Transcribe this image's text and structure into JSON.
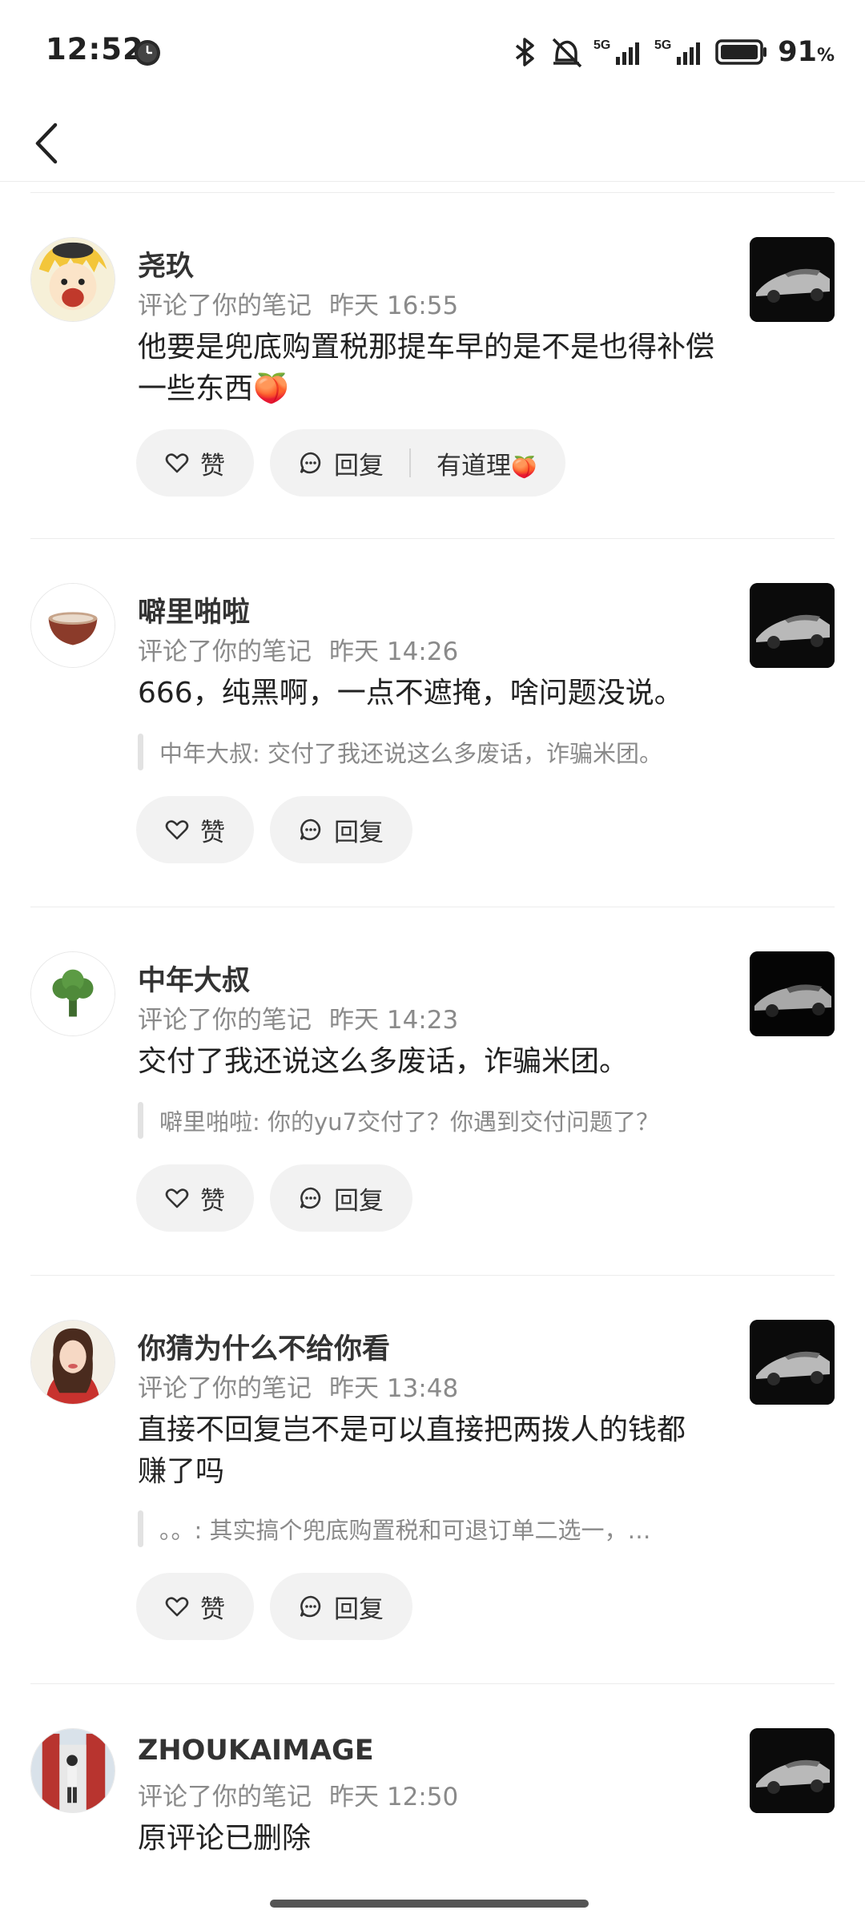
{
  "status_bar": {
    "time": "12:52",
    "battery_value": "91",
    "battery_unit": "%",
    "signal_label_1": "5G",
    "signal_label_2": "5G",
    "icons": [
      "clock-app-icon",
      "bluetooth-icon",
      "mute-icon",
      "signal-icon",
      "battery-icon"
    ]
  },
  "nav": {
    "back_icon": "chevron-left-icon",
    "title": ""
  },
  "comments": [
    {
      "username": "尧玖",
      "action": "评论了你的笔记",
      "time": "昨天 16:55",
      "text": "他要是兜底购置税那提车早的是不是也得补偿一些东西",
      "text_emoji": "🍑",
      "like_label": "赞",
      "reply_label": "回复",
      "extra_label": "有道理",
      "extra_emoji": "🍑"
    },
    {
      "username": "噼里啪啦",
      "action": "评论了你的笔记",
      "time": "昨天 14:26",
      "text": "666，纯黑啊，一点不遮掩，啥问题没说。",
      "quote": "中年大叔: 交付了我还说这么多废话，诈骗米团。",
      "like_label": "赞",
      "reply_label": "回复"
    },
    {
      "username": "中年大叔",
      "action": "评论了你的笔记",
      "time": "昨天 14:23",
      "text": "交付了我还说这么多废话，诈骗米团。",
      "quote": "噼里啪啦: 你的yu7交付了？你遇到交付问题了？",
      "like_label": "赞",
      "reply_label": "回复"
    },
    {
      "username": "你猜为什么不给你看",
      "action": "评论了你的笔记",
      "time": "昨天 13:48",
      "text": "直接不回复岂不是可以直接把两拨人的钱都赚了吗",
      "quote": "。。: 其实搞个兜底购置税和可退订单二选一，…",
      "like_label": "赞",
      "reply_label": "回复"
    },
    {
      "username": "ZHOUKAIMAGE",
      "action": "评论了你的笔记",
      "time": "昨天 12:50",
      "text": "原评论已删除"
    }
  ],
  "colors": {
    "pill_bg": "#f2f2f2",
    "meta_text": "#8a8a8a",
    "separator": "#ececec"
  }
}
